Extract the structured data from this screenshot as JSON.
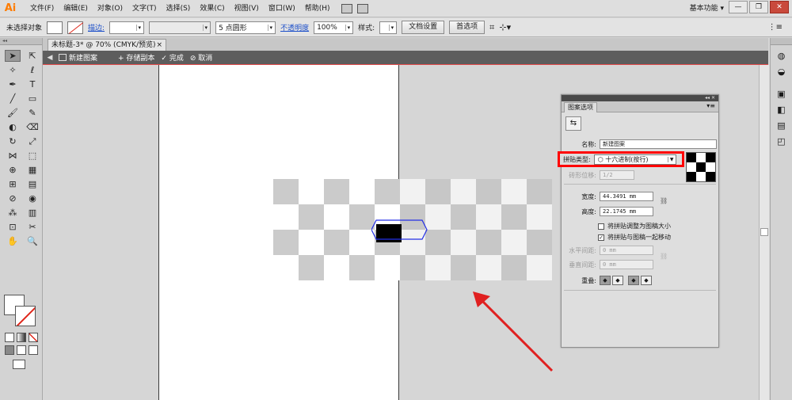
{
  "app": {
    "logo": "Ai",
    "workspace": "基本功能 ▾"
  },
  "menu": [
    "文件(F)",
    "编辑(E)",
    "对象(O)",
    "文字(T)",
    "选择(S)",
    "效果(C)",
    "视图(V)",
    "窗口(W)",
    "帮助(H)"
  ],
  "window_buttons": {
    "minimize": "—",
    "restore": "❐",
    "close": "✕"
  },
  "control_bar": {
    "selection_label": "未选择对象",
    "stroke_link": "描边:",
    "brush_preset": "5 点圆形",
    "opacity_link": "不透明度",
    "opacity_value": "100%",
    "style_label": "样式:",
    "doc_setup": "文档设置",
    "preferences": "首选项"
  },
  "document_tab": {
    "title": "未标题-3* @ 70% (CMYK/预览)",
    "close": "×"
  },
  "isolation_bar": {
    "breadcrumb": "新建图案",
    "save_copy": "+ 存储副本",
    "done": "✓ 完成",
    "cancel": "⊘ 取消"
  },
  "left_tools": [
    {
      "name": "selection-tool-icon",
      "glyph": "➤",
      "active": true
    },
    {
      "name": "direct-selection-tool-icon",
      "glyph": "⇱"
    },
    {
      "name": "magic-wand-tool-icon",
      "glyph": "✧"
    },
    {
      "name": "lasso-tool-icon",
      "glyph": "ℓ"
    },
    {
      "name": "pen-tool-icon",
      "glyph": "✒"
    },
    {
      "name": "type-tool-icon",
      "glyph": "T"
    },
    {
      "name": "line-tool-icon",
      "glyph": "╱"
    },
    {
      "name": "rectangle-tool-icon",
      "glyph": "▭"
    },
    {
      "name": "paintbrush-tool-icon",
      "glyph": "🖌"
    },
    {
      "name": "pencil-tool-icon",
      "glyph": "✎"
    },
    {
      "name": "blob-brush-tool-icon",
      "glyph": "◐"
    },
    {
      "name": "eraser-tool-icon",
      "glyph": "⌫"
    },
    {
      "name": "rotate-tool-icon",
      "glyph": "↻"
    },
    {
      "name": "scale-tool-icon",
      "glyph": "⤢"
    },
    {
      "name": "width-tool-icon",
      "glyph": "⋈"
    },
    {
      "name": "free-transform-tool-icon",
      "glyph": "⬚"
    },
    {
      "name": "shape-builder-tool-icon",
      "glyph": "⊕"
    },
    {
      "name": "perspective-grid-tool-icon",
      "glyph": "▦"
    },
    {
      "name": "mesh-tool-icon",
      "glyph": "⊞"
    },
    {
      "name": "gradient-tool-icon",
      "glyph": "▤"
    },
    {
      "name": "eyedropper-tool-icon",
      "glyph": "⊘"
    },
    {
      "name": "blend-tool-icon",
      "glyph": "◉"
    },
    {
      "name": "symbol-sprayer-tool-icon",
      "glyph": "⁂"
    },
    {
      "name": "column-graph-tool-icon",
      "glyph": "▥"
    },
    {
      "name": "artboard-tool-icon",
      "glyph": "⊡"
    },
    {
      "name": "slice-tool-icon",
      "glyph": "✂"
    },
    {
      "name": "hand-tool-icon",
      "glyph": "✋"
    },
    {
      "name": "zoom-tool-icon",
      "glyph": "🔍"
    }
  ],
  "right_strip_icons": [
    "color-guide-icon",
    "color-icon",
    "gradient-icon",
    "transparency-icon",
    "stroke-icon",
    "appearance-icon"
  ],
  "pattern_panel": {
    "tab_title": "图案选项",
    "collapse": "◂◂",
    "close": "✕",
    "menu": "▾≡",
    "name_label": "名称:",
    "name_value": "新建图案",
    "tile_type_label": "拼贴类型:",
    "tile_type_value": "⬡ 十六进制(按行)",
    "brick_offset_label": "砖形位移:",
    "brick_offset_value": "1/2",
    "width_label": "宽度:",
    "width_value": "44.3491 mm",
    "height_label": "高度:",
    "height_value": "22.1745 mm",
    "option_resize": "将拼贴调整为图稿大小",
    "option_move": "将拼贴与图稿一起移动",
    "h_spacing_label": "水平间距:",
    "h_spacing_value": "0 mm",
    "v_spacing_label": "垂直间距:",
    "v_spacing_value": "0 mm",
    "overlap_label": "重叠:"
  }
}
